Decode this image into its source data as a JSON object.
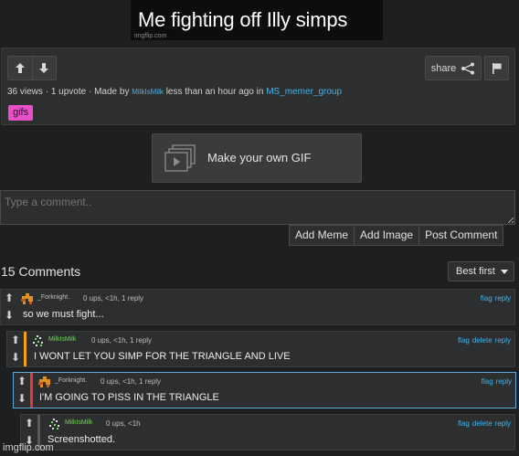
{
  "gif": {
    "caption": "Me fighting off Illy simps",
    "watermark": "imgflip.com"
  },
  "actions": {
    "share_label": "share"
  },
  "meta": {
    "views": "36 views",
    "upvotes": "1 upvote",
    "made_by": "Made by",
    "author": "MilkIsMilk",
    "time": "less than an hour ago in",
    "stream": "MS_memer_group",
    "sep": "·"
  },
  "tags": [
    "gifs"
  ],
  "make_gif": {
    "label": "Make your own GIF"
  },
  "composer": {
    "placeholder": "Type a comment..",
    "buttons": [
      "Add Meme",
      "Add Image",
      "Post Comment"
    ]
  },
  "comments_header": {
    "count": "15 Comments",
    "sort": "Best first"
  },
  "comments": [
    {
      "user": "_Forknight.",
      "meta": "0 ups, <1h, 1 reply",
      "text": "so we must fight...",
      "actions": [
        "flag",
        "reply"
      ],
      "bar_color": "#2d2e30"
    },
    {
      "user": "MilkIsMilk",
      "meta": "0 ups, <1h, 1 reply",
      "text": "I WONT LET YOU SIMP FOR THE TRIANGLE AND LIVE",
      "actions": [
        "flag",
        "delete",
        "reply"
      ],
      "bar_color": "#f2a20c"
    },
    {
      "user": "_Forknight.",
      "meta": "0 ups, <1h, 1 reply",
      "text": "I'M GOING TO PISS IN THE TRIANGLE",
      "actions": [
        "flag",
        "reply"
      ],
      "bar_color": "#e53838"
    },
    {
      "user": "MilkIsMilk",
      "meta": "0 ups, <1h",
      "text": "Screenshotted.",
      "actions": [
        "flag",
        "delete",
        "reply"
      ],
      "bar_color": "#5a5a5a"
    }
  ],
  "footer": {
    "watermark": "imgflip.com"
  },
  "colors": {
    "link": "#44b4e8",
    "tag": "#e94fc9",
    "highlight": "#5aa9d6",
    "username_green": "#6ddc4f"
  }
}
